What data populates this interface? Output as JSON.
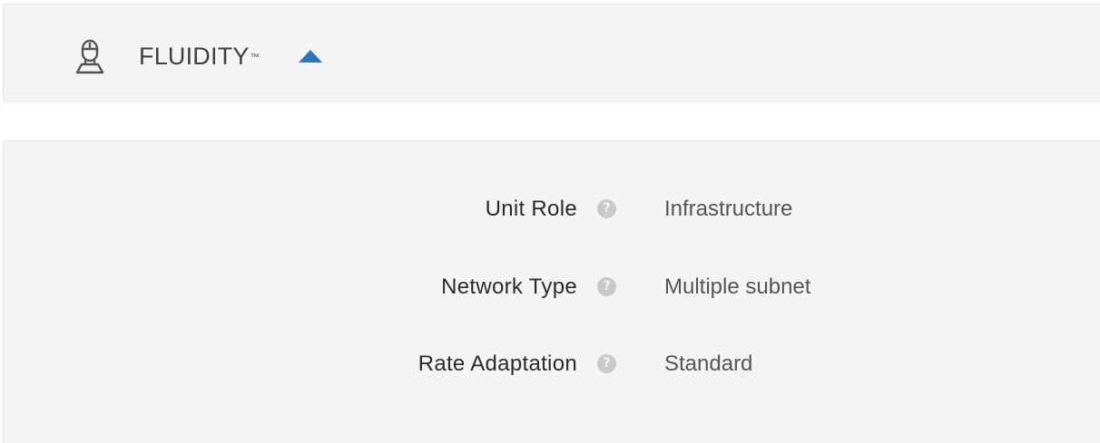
{
  "header": {
    "icon": "fluidity-user-icon",
    "title": "FLUIDITY",
    "trademark": "™",
    "toggle_icon": "caret-up-icon",
    "accent_color": "#2f74b6"
  },
  "settings": {
    "rows": [
      {
        "label": "Unit Role",
        "help_icon": "help-icon",
        "help_glyph": "?",
        "value": "Infrastructure"
      },
      {
        "label": "Network Type",
        "help_icon": "help-icon",
        "help_glyph": "?",
        "value": "Multiple subnet"
      },
      {
        "label": "Rate Adaptation",
        "help_icon": "help-icon",
        "help_glyph": "?",
        "value": "Standard"
      }
    ]
  }
}
